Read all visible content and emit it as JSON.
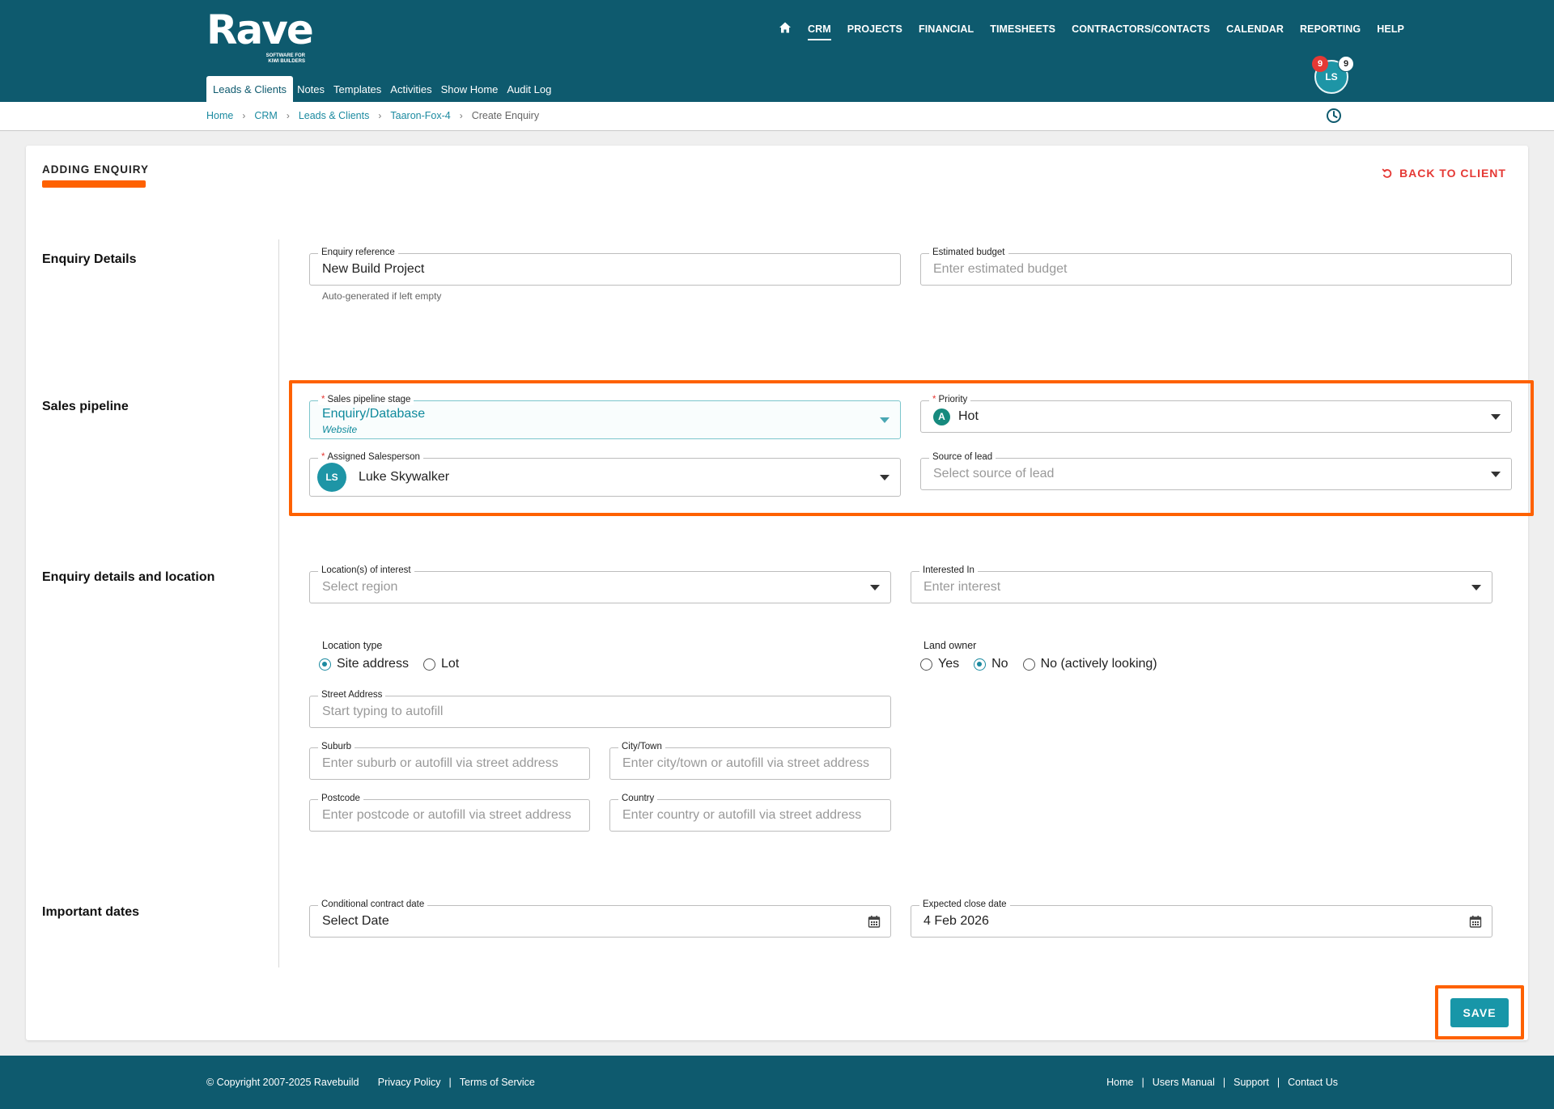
{
  "brand": {
    "name": "Rave",
    "tagline_1": "SOFTWARE FOR",
    "tagline_2": "KIWI BUILDERS"
  },
  "main_nav": [
    "CRM",
    "PROJECTS",
    "FINANCIAL",
    "TIMESHEETS",
    "CONTRACTORS/CONTACTS",
    "CALENDAR",
    "REPORTING",
    "HELP"
  ],
  "sub_nav": [
    "Leads & Clients",
    "Notes",
    "Templates",
    "Activities",
    "Show Home",
    "Audit Log"
  ],
  "user": {
    "initials": "LS",
    "badge_red": "9",
    "badge_white": "9"
  },
  "breadcrumb": [
    "Home",
    "CRM",
    "Leads & Clients",
    "Taaron-Fox-4",
    "Create Enquiry"
  ],
  "page": {
    "title": "ADDING ENQUIRY",
    "back_label": "BACK TO CLIENT"
  },
  "sections": {
    "enquiry_details": "Enquiry Details",
    "sales_pipeline": "Sales pipeline",
    "details_location": "Enquiry details and location",
    "important_dates": "Important dates"
  },
  "enquiry_details": {
    "reference": {
      "label": "Enquiry reference",
      "value": "New Build Project",
      "helper": "Auto-generated if left empty"
    },
    "budget": {
      "label": "Estimated budget",
      "placeholder": "Enter estimated budget"
    }
  },
  "sales_pipeline": {
    "stage": {
      "label": "Sales pipeline stage",
      "value": "Enquiry/Database",
      "sub": "Website"
    },
    "priority": {
      "label": "Priority",
      "badge": "A",
      "value": "Hot"
    },
    "salesperson": {
      "label": "Assigned Salesperson",
      "initials": "LS",
      "value": "Luke Skywalker"
    },
    "source": {
      "label": "Source of lead",
      "placeholder": "Select source of lead"
    }
  },
  "location": {
    "locations": {
      "label": "Location(s) of interest",
      "placeholder": "Select region"
    },
    "interested_in": {
      "label": "Interested In",
      "placeholder": "Enter interest"
    },
    "location_type": {
      "label": "Location type",
      "options": [
        "Site address",
        "Lot"
      ],
      "selected": "Site address"
    },
    "land_owner": {
      "label": "Land owner",
      "options": [
        "Yes",
        "No",
        "No (actively looking)"
      ],
      "selected": "No"
    },
    "street": {
      "label": "Street Address",
      "placeholder": "Start typing to autofill"
    },
    "suburb": {
      "label": "Suburb",
      "placeholder": "Enter suburb or autofill via street address"
    },
    "city": {
      "label": "City/Town",
      "placeholder": "Enter city/town or autofill via street address"
    },
    "postcode": {
      "label": "Postcode",
      "placeholder": "Enter postcode or autofill via street address"
    },
    "country": {
      "label": "Country",
      "placeholder": "Enter country or autofill via street address"
    }
  },
  "dates": {
    "conditional": {
      "label": "Conditional contract date",
      "value": "Select Date"
    },
    "expected_close": {
      "label": "Expected close date",
      "value": "4 Feb 2026"
    }
  },
  "actions": {
    "save": "SAVE"
  },
  "footer": {
    "copyright": "© Copyright 2007-2025 Ravebuild",
    "left_links": [
      "Privacy Policy",
      "Terms of Service"
    ],
    "right_links": [
      "Home",
      "Users Manual",
      "Support",
      "Contact Us"
    ]
  },
  "colors": {
    "header": "#0e5a6e",
    "accent": "#fe6100",
    "teal": "#1896a8",
    "danger": "#e53935"
  }
}
